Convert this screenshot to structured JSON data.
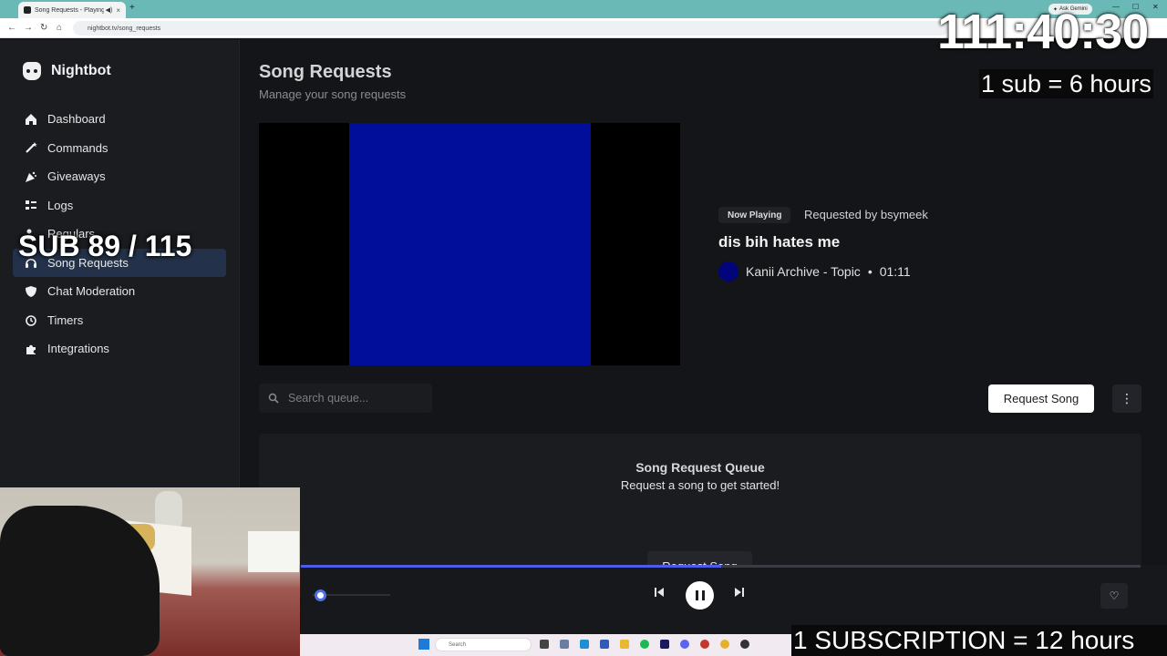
{
  "browser": {
    "tab_title": "Song Requests - Playing di",
    "new_tab": "+",
    "ask_gemini": "Ask Gemini",
    "url": "nightbot.tv/song_requests"
  },
  "sidebar": {
    "brand": "Nightbot",
    "items": [
      {
        "label": "Dashboard",
        "icon": "home-icon"
      },
      {
        "label": "Commands",
        "icon": "wand-icon"
      },
      {
        "label": "Giveaways",
        "icon": "party-icon"
      },
      {
        "label": "Logs",
        "icon": "list-icon"
      },
      {
        "label": "Regulars",
        "icon": "users-icon"
      },
      {
        "label": "Song Requests",
        "icon": "headphones-icon",
        "active": true
      },
      {
        "label": "Chat Moderation",
        "icon": "shield-icon"
      },
      {
        "label": "Timers",
        "icon": "alarm-icon"
      },
      {
        "label": "Integrations",
        "icon": "puzzle-icon"
      }
    ]
  },
  "page": {
    "title": "Song Requests",
    "subtitle": "Manage your song requests"
  },
  "now_playing": {
    "badge": "Now Playing",
    "requested_by": "Requested by bsymeek",
    "song_title": "dis bih hates me",
    "artist": "Kanii Archive - Topic",
    "separator": "•",
    "duration": "01:11"
  },
  "queue": {
    "search_placeholder": "Search queue...",
    "request_button": "Request Song",
    "title": "Song Request Queue",
    "empty_text": "Request a song to get started!",
    "queue_request_button": "Request Song"
  },
  "player": {
    "progress_fraction": 0.5,
    "volume_fraction": 0.05
  },
  "overlay": {
    "timer": "111:40:30",
    "sub_hours": "1 sub = 6 hours",
    "sub_count": "SUB 89 / 115",
    "subscription_hours": "1 SUBSCRIPTION = 12 hours"
  },
  "taskbar": {
    "search": "Search"
  },
  "colors": {
    "accent": "#4c5ce6",
    "active_nav": "#23324a",
    "video_fill": "#000e9a"
  }
}
